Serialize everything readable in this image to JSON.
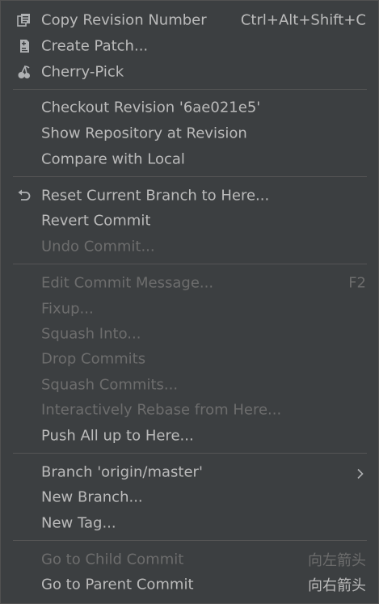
{
  "menu": {
    "items": [
      {
        "label": "Copy Revision Number",
        "shortcut": "Ctrl+Alt+Shift+C",
        "icon": "copy-icon",
        "enabled": true
      },
      {
        "label": "Create Patch...",
        "icon": "patch-icon",
        "enabled": true
      },
      {
        "label": "Cherry-Pick",
        "icon": "cherry-pick-icon",
        "enabled": true
      },
      {
        "label": "Checkout Revision '6ae021e5'",
        "enabled": true
      },
      {
        "label": "Show Repository at Revision",
        "enabled": true
      },
      {
        "label": "Compare with Local",
        "enabled": true
      },
      {
        "label": "Reset Current Branch to Here...",
        "icon": "undo-arrow-icon",
        "enabled": true
      },
      {
        "label": "Revert Commit",
        "enabled": true
      },
      {
        "label": "Undo Commit...",
        "enabled": false
      },
      {
        "label": "Edit Commit Message...",
        "shortcut": "F2",
        "enabled": false
      },
      {
        "label": "Fixup...",
        "enabled": false
      },
      {
        "label": "Squash Into...",
        "enabled": false
      },
      {
        "label": "Drop Commits",
        "enabled": false
      },
      {
        "label": "Squash Commits...",
        "enabled": false
      },
      {
        "label": "Interactively Rebase from Here...",
        "enabled": false
      },
      {
        "label": "Push All up to Here...",
        "enabled": true
      },
      {
        "label": "Branch 'origin/master'",
        "submenu": true,
        "icon": "chevron-right-icon",
        "enabled": true
      },
      {
        "label": "New Branch...",
        "enabled": true
      },
      {
        "label": "New Tag...",
        "enabled": true
      },
      {
        "label": "Go to Child Commit",
        "shortcut": "向左箭头",
        "enabled": false
      },
      {
        "label": "Go to Parent Commit",
        "shortcut": "向右箭头",
        "enabled": true
      }
    ]
  },
  "colors": {
    "background": "#3c3f41",
    "text": "#bbbbbb",
    "disabled_text": "#6d6d6d",
    "separator": "#555555"
  }
}
